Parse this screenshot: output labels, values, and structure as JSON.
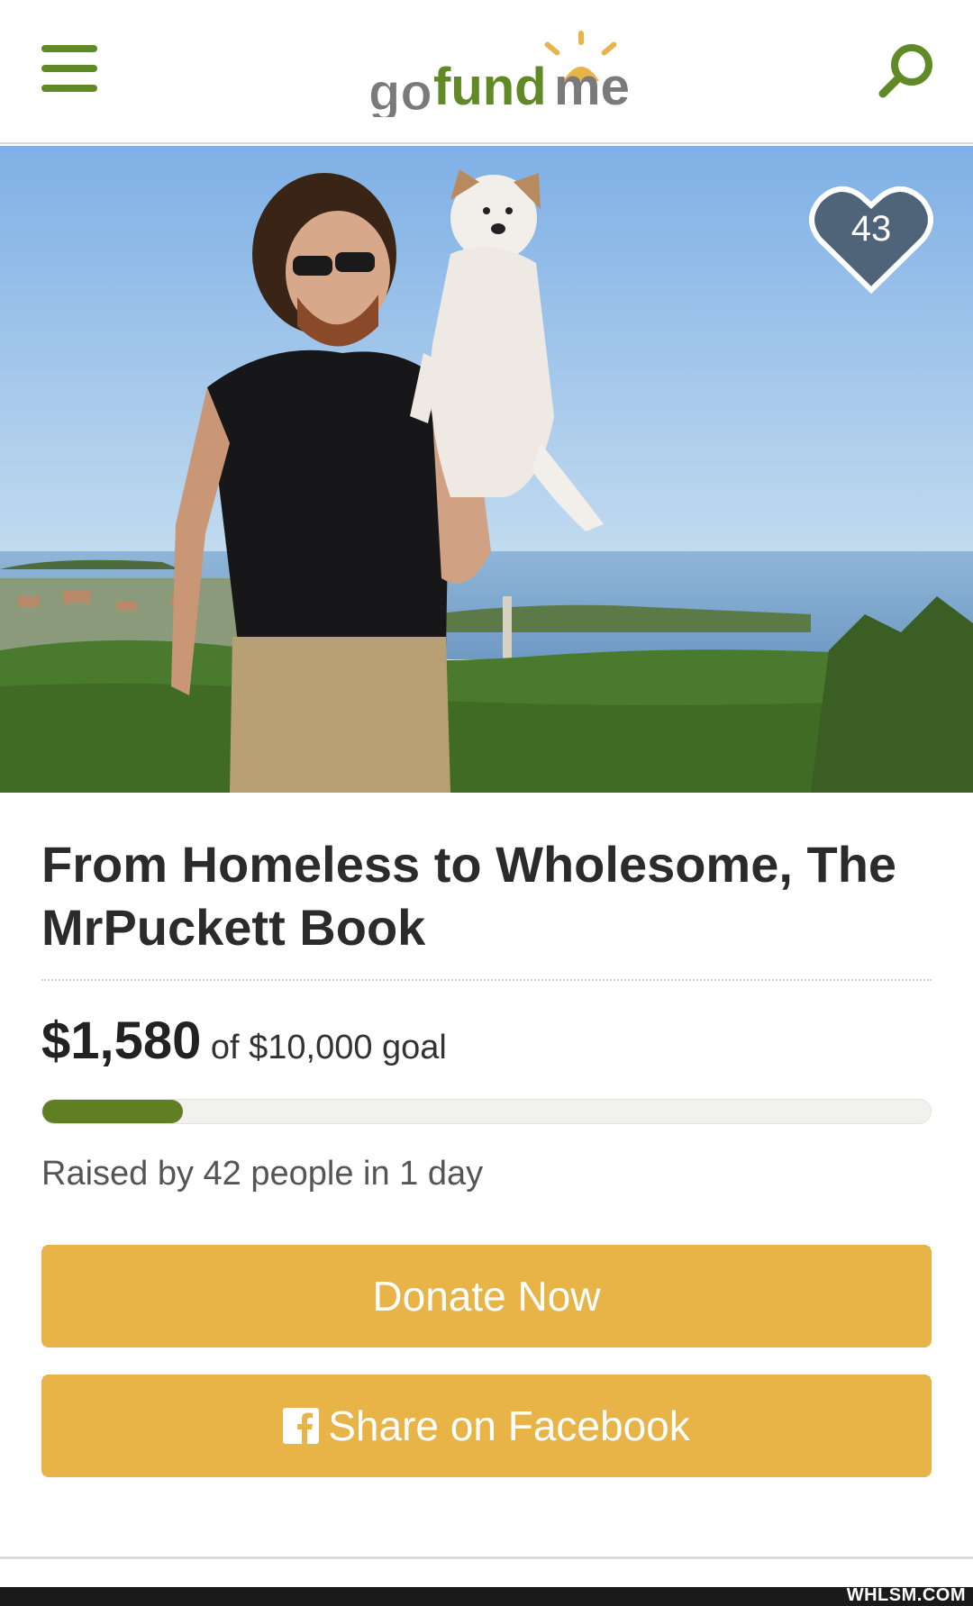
{
  "header": {
    "logo_text": "gofundme",
    "menu_icon": "hamburger-menu-icon",
    "search_icon": "search-icon",
    "brand_color": "#5f8a26",
    "logo_sun_color": "#e8b448"
  },
  "campaign": {
    "likes": "43",
    "title": "From Homeless to Wholesome, The MrPuckett Book",
    "raised": "$1,580",
    "goal_text": "of $10,000 goal",
    "progress_fraction": 0.158,
    "raised_by": "Raised by 42 people in 1 day"
  },
  "actions": {
    "donate_label": "Donate Now",
    "share_label": "Share on Facebook",
    "button_color": "#e8b448",
    "share_icon": "facebook-icon"
  },
  "footer": {
    "watermark": "WHLSM.COM"
  }
}
